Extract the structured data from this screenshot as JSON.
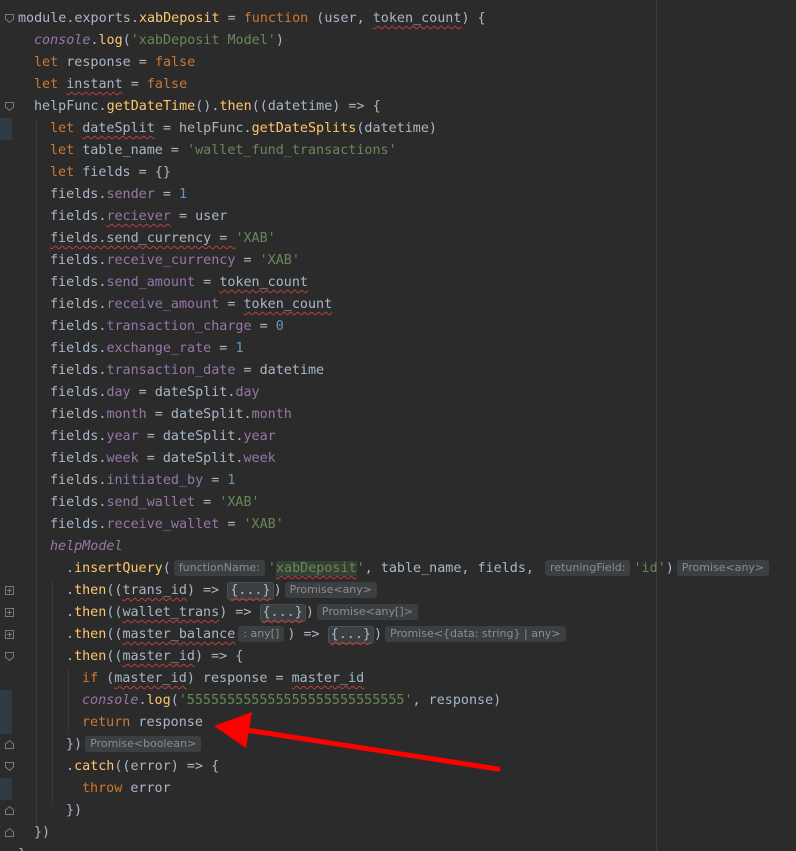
{
  "editor": {
    "colors": {
      "background": "#2b2b2b",
      "keyword": "#cc7832",
      "function": "#ffc66d",
      "property": "#9876aa",
      "string": "#6a8759",
      "number": "#6897bb",
      "text": "#a9b7c6",
      "annotation_arrow": "#ff0000"
    },
    "lines": [
      {
        "indent": 0,
        "html": "<span class='plain'>module.exports.</span><span class='fn'>xabDeposit</span><span class='plain'> = </span><span class='kw'>function</span><span class='plain'> (user, </span><span class='plain squig'>token_count</span><span class='plain'>) {</span>"
      },
      {
        "indent": 1,
        "html": "<span class='prop it'>console</span><span class='plain'>.</span><span class='fn'>log</span><span class='plain'>(</span><span class='str'>'xabDeposit Model'</span><span class='plain'>)</span>"
      },
      {
        "indent": 1,
        "html": "<span class='kw'>let</span><span class='plain'> response = </span><span class='kw'>false</span>"
      },
      {
        "indent": 1,
        "html": "<span class='kw'>let</span><span class='plain'> </span><span class='plain squig'>instant</span><span class='plain'> = </span><span class='kw'>false</span>"
      },
      {
        "indent": 1,
        "html": "<span class='plain'>helpFunc.</span><span class='fn'>getDateTime</span><span class='plain'>().</span><span class='fn'>then</span><span class='plain'>((datetime) => {</span>"
      },
      {
        "indent": 2,
        "html": "<span class='kw'>let</span><span class='plain'> </span><span class='plain squig'>dateSplit</span><span class='plain'> = helpFunc.</span><span class='fn'>getDateSplits</span><span class='plain'>(datetime)</span>"
      },
      {
        "indent": 2,
        "html": "<span class='kw'>let</span><span class='plain'> table_name = </span><span class='str'>'wallet_fund_transactions'</span>"
      },
      {
        "indent": 2,
        "html": "<span class='kw'>let</span><span class='plain'> fields = </span><span class='plain'>{}</span>"
      },
      {
        "indent": 2,
        "html": "<span class='plain'>fields.</span><span class='prop'>sender</span><span class='plain'> = </span><span class='num'>1</span>"
      },
      {
        "indent": 2,
        "html": "<span class='plain'>fields.</span><span class='prop squig'>reciever</span><span class='plain'> = user</span>"
      },
      {
        "indent": 2,
        "html": "<span class='plain squig'>fields.send_currency = </span><span class='str'>'XAB'</span>"
      },
      {
        "indent": 2,
        "html": "<span class='plain'>fields.</span><span class='prop'>receive_currency</span><span class='plain'> = </span><span class='str'>'XAB'</span>"
      },
      {
        "indent": 2,
        "html": "<span class='plain'>fields.</span><span class='prop'>send_amount</span><span class='plain'> = </span><span class='plain squig'>token_count</span>"
      },
      {
        "indent": 2,
        "html": "<span class='plain'>fields.</span><span class='prop'>receive_amount</span><span class='plain'> = </span><span class='plain squig'>token_count</span>"
      },
      {
        "indent": 2,
        "html": "<span class='plain'>fields.</span><span class='prop'>transaction_charge</span><span class='plain'> = </span><span class='num'>0</span>"
      },
      {
        "indent": 2,
        "html": "<span class='plain'>fields.</span><span class='prop'>exchange_rate</span><span class='plain'> = </span><span class='num'>1</span>"
      },
      {
        "indent": 2,
        "html": "<span class='plain'>fields.</span><span class='prop'>transaction_date</span><span class='plain'> = datetime</span>"
      },
      {
        "indent": 2,
        "html": "<span class='plain'>fields.</span><span class='prop'>day</span><span class='plain'> = dateSplit.</span><span class='prop'>day</span>"
      },
      {
        "indent": 2,
        "html": "<span class='plain'>fields.</span><span class='prop'>month</span><span class='plain'> = dateSplit.</span><span class='prop'>month</span>"
      },
      {
        "indent": 2,
        "html": "<span class='plain'>fields.</span><span class='prop'>year</span><span class='plain'> = dateSplit.</span><span class='prop'>year</span>"
      },
      {
        "indent": 2,
        "html": "<span class='plain'>fields.</span><span class='prop'>week</span><span class='plain'> = dateSplit.</span><span class='prop'>week</span>"
      },
      {
        "indent": 2,
        "html": "<span class='plain'>fields.</span><span class='prop'>initiated_by</span><span class='plain'> = </span><span class='num'>1</span>"
      },
      {
        "indent": 2,
        "html": "<span class='plain'>fields.</span><span class='prop'>send_wallet</span><span class='plain'> = </span><span class='str'>'XAB'</span>"
      },
      {
        "indent": 2,
        "html": "<span class='plain'>fields.</span><span class='prop'>receive_wallet</span><span class='plain'> = </span><span class='str'>'XAB'</span>"
      },
      {
        "indent": 2,
        "html": "<span class='prop it'>helpModel</span>"
      },
      {
        "indent": 3,
        "html": "<span class='plain'>.</span><span class='fn'>insertQuery</span><span class='plain'>(</span><span class='hint'>functionName:</span><span class='str'>'<span class=\"hl-str squig\">xabDeposit</span>'</span><span class='plain'>, table_name, fields, </span><span class='hint'>retuningField:</span><span class='str'>'id'</span><span class='plain'>)</span><span class='hint'>Promise&lt;any&gt;</span>"
      },
      {
        "indent": 3,
        "html": "<span class='plain'>.</span><span class='fn'>then</span><span class='plain'>((</span><span class='plain squig'>trans_id</span><span class='plain'>) => </span><span class='fold squig'>{...}</span><span class='plain'>)</span><span class='hint'>Promise&lt;any&gt;</span>"
      },
      {
        "indent": 3,
        "html": "<span class='plain'>.</span><span class='fn'>then</span><span class='plain'>((</span><span class='plain squig'>wallet_trans</span><span class='plain'>) => </span><span class='fold squig'>{...}</span><span class='plain'>)</span><span class='hint'>Promise&lt;any[]&gt;</span>"
      },
      {
        "indent": 3,
        "html": "<span class='plain'>.</span><span class='fn'>then</span><span class='plain'>((</span><span class='plain squig'>master_balance</span><span class='hint'>: any[]</span><span class='plain'>) => </span><span class='fold squig'>{...}</span><span class='plain'>)</span><span class='hint'>Promise&lt;{data: string} | any&gt;</span>"
      },
      {
        "indent": 3,
        "html": "<span class='plain'>.</span><span class='fn'>then</span><span class='plain'>((</span><span class='plain squig'>master_id</span><span class='plain'>) => {</span>"
      },
      {
        "indent": 4,
        "html": "<span class='kw'>if</span><span class='plain'> (</span><span class='plain squig'>master_id</span><span class='plain'>) response = </span><span class='plain squig'>master_id</span>"
      },
      {
        "indent": 4,
        "html": "<span class='prop it'>console</span><span class='plain'>.</span><span class='fn'>log</span><span class='plain'>(</span><span class='str'>'555555555555555555555555555'</span><span class='plain'>, response)</span>"
      },
      {
        "indent": 4,
        "html": "<span class='kw'>return</span><span class='plain'> response</span>"
      },
      {
        "indent": 3,
        "html": "<span class='plain'>})</span><span class='hint'>Promise&lt;boolean&gt;</span>"
      },
      {
        "indent": 3,
        "html": "<span class='plain'>.</span><span class='fn'>catch</span><span class='plain'>((error) => {</span>"
      },
      {
        "indent": 4,
        "html": "<span class='kw'>throw</span><span class='plain'> error</span>"
      },
      {
        "indent": 3,
        "html": "<span class='plain'>})</span>"
      },
      {
        "indent": 1,
        "html": "<span class='plain'>})</span>"
      },
      {
        "indent": 0,
        "html": "<span class='plain'>}</span>"
      }
    ]
  }
}
